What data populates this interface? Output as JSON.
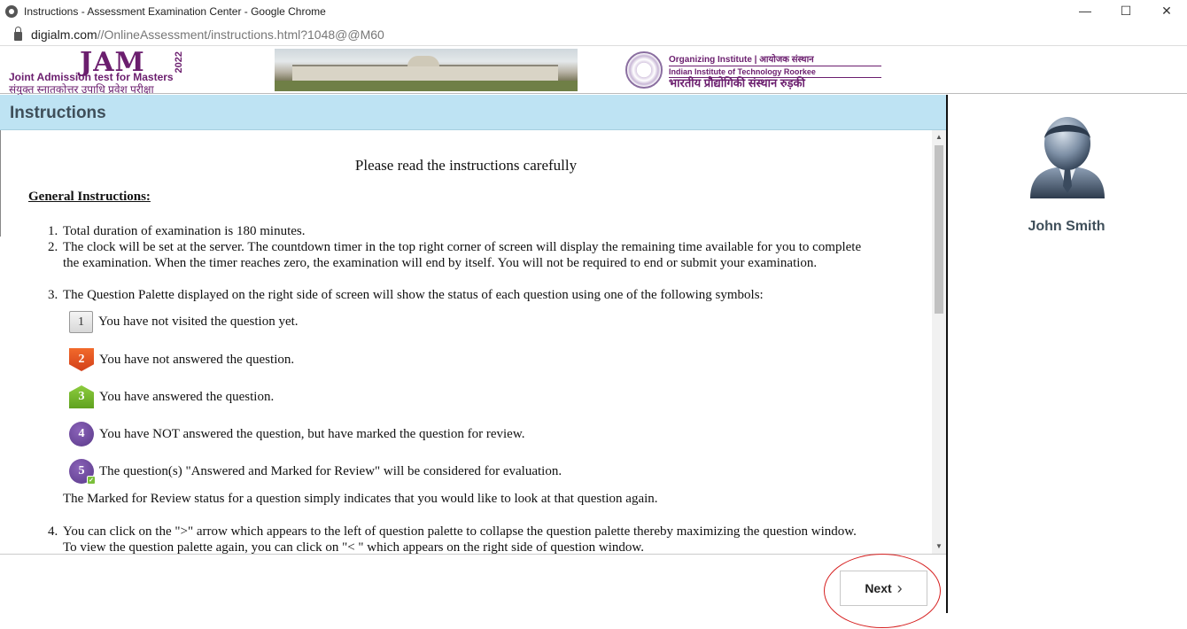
{
  "browser": {
    "window_title": "Instructions - Assessment Examination Center - Google Chrome",
    "url_host": "digialm.com",
    "url_path": "//OnlineAssessment/instructions.html?1048@@M60"
  },
  "banner": {
    "jam_title": "JAM",
    "jam_year": "2022",
    "jam_subtitle": "Joint Admission test for Masters",
    "jam_hindi": "संयुक्त स्नातकोत्तर उपाधि प्रवेश परीक्षा",
    "org_line1": "Organizing Institute | आयोजक संस्थान",
    "org_line2": "Indian Institute of Technology Roorkee",
    "org_line3": "भारतीय प्रौद्योगिकी संस्थान रुड़की"
  },
  "instructions": {
    "header": "Instructions",
    "please_read": "Please read the instructions carefully",
    "general_title": "General Instructions:",
    "items": [
      {
        "num": "1.",
        "text": "Total duration of examination is 180 minutes."
      },
      {
        "num": "2.",
        "text": "The clock will be set at the server. The countdown timer in the top right corner of screen will display the remaining time available for you to complete the examination. When the timer reaches zero, the examination will end by itself. You will not be required to end or submit your examination."
      },
      {
        "num": "3.",
        "text": "The Question Palette displayed on the right side of screen will show the status of each question using one of the following symbols:"
      },
      {
        "num": "4.",
        "text": "You can click on the \">\" arrow which appears to the left of question palette to collapse the question palette thereby maximizing the question window. To view the question palette again, you can click on \"< \" which appears on the right side of question window."
      }
    ],
    "legend": [
      {
        "symbol": "1",
        "text": "You have not visited the question yet."
      },
      {
        "symbol": "2",
        "text": "You have not answered the question."
      },
      {
        "symbol": "3",
        "text": "You have answered the question."
      },
      {
        "symbol": "4",
        "text": "You have NOT answered the question, but have marked the question for review."
      },
      {
        "symbol": "5",
        "text": "The question(s) \"Answered and Marked for Review\" will be considered for evaluation."
      }
    ],
    "marked_note": "The Marked for Review status for a question simply indicates that you would like to look at that question again."
  },
  "footer": {
    "next_label": "Next"
  },
  "profile": {
    "name": "John Smith"
  },
  "colors": {
    "header_bg": "#bee3f3",
    "not_answered": "#e0501f",
    "answered": "#6fb22a",
    "marked": "#6a479c",
    "annotation": "#d62020"
  }
}
